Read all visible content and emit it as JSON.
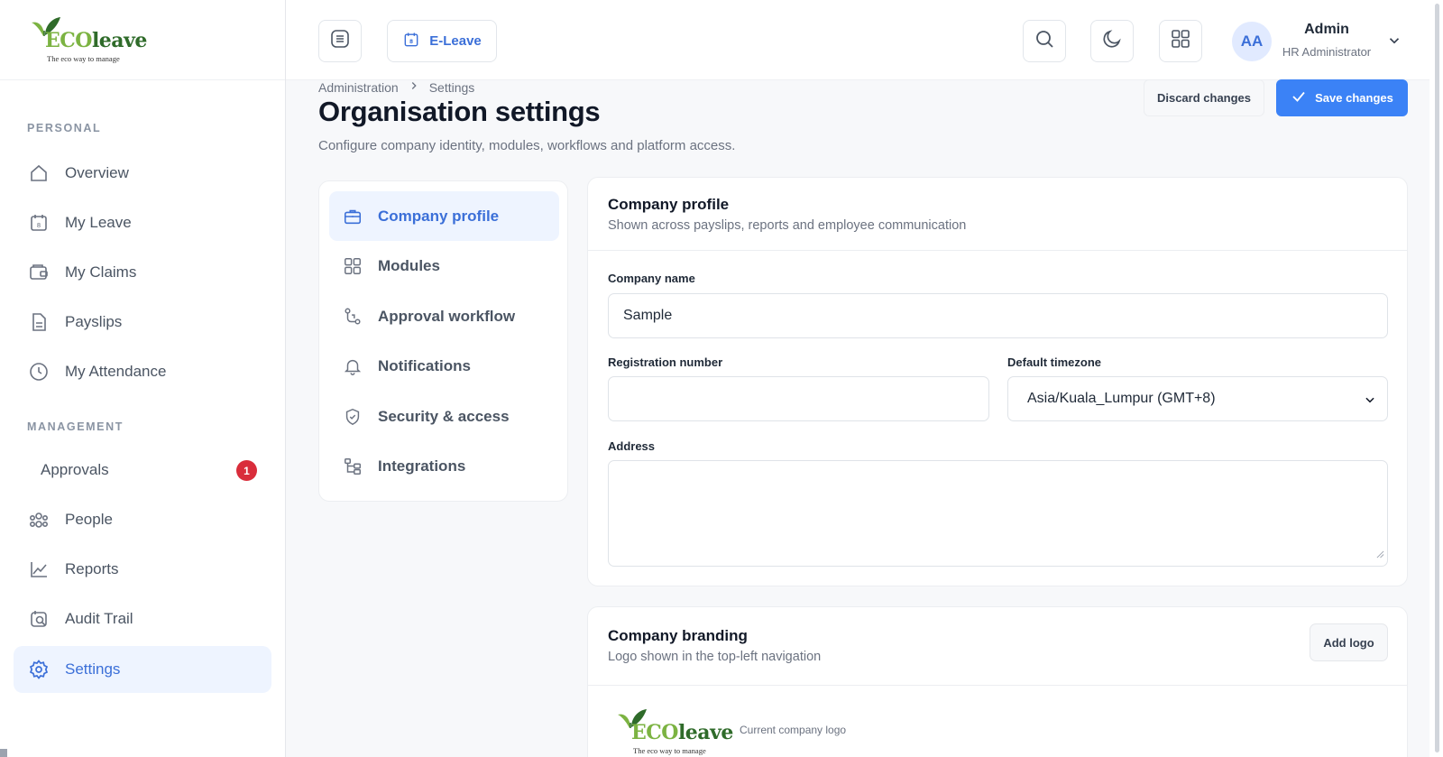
{
  "brand": {
    "logo_word_prefix": "EC",
    "logo_word_mid": "O",
    "logo_word_suffix": "leave",
    "tagline": "The eco way to manage"
  },
  "sidebar": {
    "personal_label": "PERSONAL",
    "management_label": "MANAGEMENT",
    "items": [
      {
        "label": "Overview",
        "icon": "home-icon"
      },
      {
        "label": "My Leave",
        "icon": "calendar-icon"
      },
      {
        "label": "My Claims",
        "icon": "wallet-icon"
      },
      {
        "label": "Payslips",
        "icon": "document-icon"
      },
      {
        "label": "My Attendance",
        "icon": "clock-icon"
      },
      {
        "label": "Approvals",
        "badge": "1"
      },
      {
        "label": "People",
        "icon": "people-icon"
      },
      {
        "label": "Reports",
        "icon": "chart-line-icon"
      },
      {
        "label": "Audit Trail",
        "icon": "audit-icon"
      },
      {
        "label": "Settings",
        "icon": "gear-icon",
        "active": true
      }
    ]
  },
  "topbar": {
    "app_label": "E-Leave",
    "user": {
      "initials": "AA",
      "name": "Admin",
      "role": "HR Administrator"
    }
  },
  "breadcrumb": [
    "Administration",
    "Settings"
  ],
  "page": {
    "title": "Organisation settings",
    "subtitle": "Configure company identity, modules, workflows and platform access.",
    "discard_label": "Discard changes",
    "save_label": "Save changes"
  },
  "settings_nav": [
    {
      "label": "Company profile",
      "icon": "briefcase-icon",
      "active": true
    },
    {
      "label": "Modules",
      "icon": "grid-icon"
    },
    {
      "label": "Approval workflow",
      "icon": "workflow-icon"
    },
    {
      "label": "Notifications",
      "icon": "bell-icon"
    },
    {
      "label": "Security & access",
      "icon": "shield-icon"
    },
    {
      "label": "Integrations",
      "icon": "integrations-icon"
    }
  ],
  "company_profile": {
    "title": "Company profile",
    "subtitle": "Shown across payslips, reports and employee communication",
    "company_name_label": "Company name",
    "company_name_value": "Sample",
    "registration_label": "Registration number",
    "registration_value": "",
    "timezone_label": "Default timezone",
    "timezone_value": "Asia/Kuala_Lumpur (GMT+8)",
    "address_label": "Address",
    "address_value": ""
  },
  "branding": {
    "title": "Company branding",
    "subtitle": "Logo shown in the top-left navigation",
    "add_logo_label": "Add logo",
    "logo_caption": "Current company logo"
  },
  "colors": {
    "accent": "#3b6fd8",
    "primary_button": "#3b82f6",
    "badge": "#d92d3b",
    "active_bg": "#eef4ff"
  }
}
